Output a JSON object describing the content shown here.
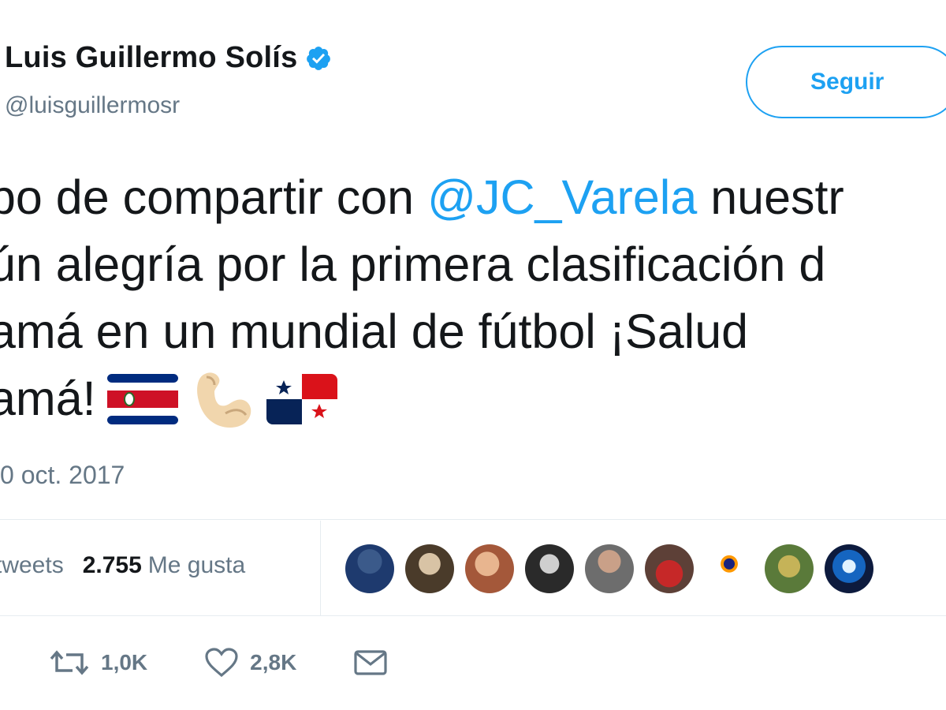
{
  "author": {
    "display_name": "Luis Guillermo Solís",
    "handle": "@luisguillermosr",
    "verified": true
  },
  "follow_button": {
    "label": "Seguir"
  },
  "tweet": {
    "line1_pre": "po de compartir con ",
    "line1_mention": "@JC_Varela",
    "line1_post": " nuestr",
    "line2": "ún alegría por la primera clasificación d",
    "line3": "amá en un mundial de fútbol ¡Salud",
    "line4": "amá!",
    "emojis": [
      "costa-rica-flag",
      "flexed-biceps",
      "panama-flag"
    ]
  },
  "timestamp": "0 oct. 2017",
  "stats": {
    "retweets_label": "tweets",
    "likes_value": "2.755",
    "likes_label": "Me gusta"
  },
  "liker_avatars_count": 9,
  "actions": {
    "retweet_count": "1,0K",
    "like_count": "2,8K"
  },
  "colors": {
    "accent": "#1da1f2",
    "text": "#14171a",
    "muted": "#657786",
    "divider": "#e6ecf0"
  }
}
